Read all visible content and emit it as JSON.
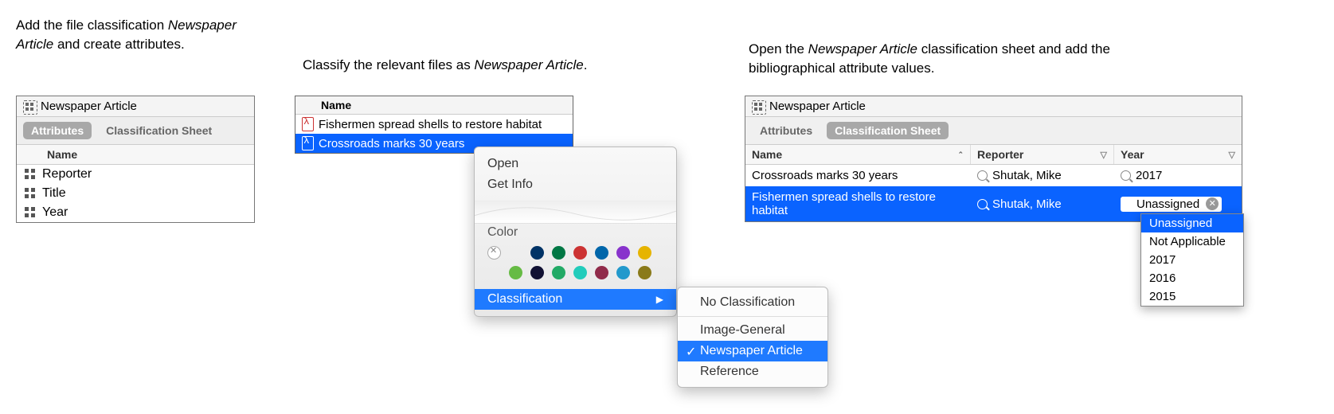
{
  "panel1": {
    "caption_pre": "Add the file classification",
    "caption_em": "Newspaper Article",
    "caption_post": " and create attributes.",
    "title": "Newspaper Article",
    "tab_attributes": "Attributes",
    "tab_sheet": "Classification Sheet",
    "col_name": "Name",
    "attrs": [
      "Reporter",
      "Title",
      "Year"
    ]
  },
  "panel2": {
    "caption_pre": "Classify the relevant files as ",
    "caption_em": "Newspaper Article",
    "caption_post": ".",
    "list_header": "Name",
    "files": [
      "Fishermen spread shells to restore habitat",
      "Crossroads marks 30 years"
    ],
    "menu": {
      "open": "Open",
      "get_info": "Get Info",
      "color_label": "Color",
      "classification": "Classification",
      "colors_row1": [
        "#d22",
        "#036",
        "#074",
        "#c33",
        "#06a",
        "#83c",
        "#e6b400"
      ],
      "colors_row2": [
        "#6b4",
        "#113",
        "#2a6",
        "#2cb",
        "#902b4a",
        "#29c",
        "#8a7a1a"
      ]
    },
    "submenu": {
      "no_class": "No Classification",
      "image_general": "Image-General",
      "newspaper": "Newspaper Article",
      "reference": "Reference"
    }
  },
  "panel3": {
    "caption_pre": "Open the ",
    "caption_em": "Newspaper Article",
    "caption_post": " classification sheet and add the bibliographical attribute values.",
    "title": "Newspaper Article",
    "tab_attributes": "Attributes",
    "tab_sheet": "Classification Sheet",
    "cols": {
      "name": "Name",
      "reporter": "Reporter",
      "year": "Year"
    },
    "rows": [
      {
        "name": "Crossroads marks 30 years",
        "reporter": "Shutak, Mike",
        "year": "2017"
      },
      {
        "name": "Fishermen spread shells to restore habitat",
        "reporter": "Shutak, Mike",
        "year": "Unassigned"
      }
    ],
    "dropdown": [
      "Unassigned",
      "Not Applicable",
      "2017",
      "2016",
      "2015"
    ]
  }
}
